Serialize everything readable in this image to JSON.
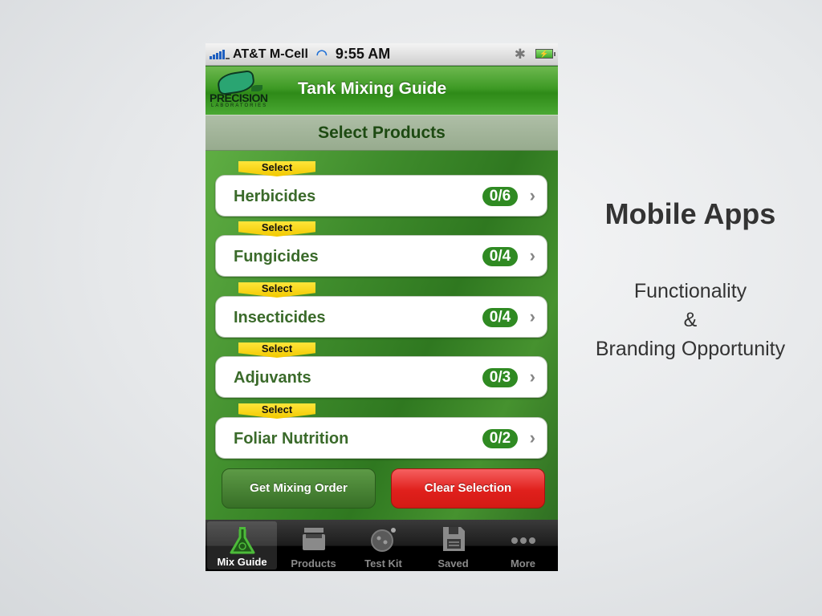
{
  "slide": {
    "title": "Mobile Apps",
    "subtitle_lines": [
      "Functionality",
      "&",
      "Branding Opportunity"
    ]
  },
  "status_bar": {
    "carrier": "AT&T M-Cell",
    "time": "9:55 AM",
    "icons": [
      "signal-icon",
      "wifi-icon",
      "bluetooth-icon",
      "battery-charging-icon"
    ]
  },
  "nav_bar": {
    "logo_word": "PRECISION",
    "logo_sub": "LABORATORIES",
    "title": "Tank Mixing Guide"
  },
  "sub_header": {
    "title": "Select Products"
  },
  "categories": [
    {
      "tag": "Select",
      "label": "Herbicides",
      "count": "0/6"
    },
    {
      "tag": "Select",
      "label": "Fungicides",
      "count": "0/4"
    },
    {
      "tag": "Select",
      "label": "Insecticides",
      "count": "0/4"
    },
    {
      "tag": "Select",
      "label": "Adjuvants",
      "count": "0/3"
    },
    {
      "tag": "Select",
      "label": "Foliar Nutrition",
      "count": "0/2"
    }
  ],
  "actions": {
    "mix_label": "Get Mixing Order",
    "clear_label": "Clear Selection"
  },
  "tab_bar": {
    "tabs": [
      {
        "label": "Mix Guide",
        "icon": "flask-icon",
        "active": true
      },
      {
        "label": "Products",
        "icon": "tray-icon",
        "active": false
      },
      {
        "label": "Test Kit",
        "icon": "test-kit-icon",
        "active": false
      },
      {
        "label": "Saved",
        "icon": "floppy-disk-icon",
        "active": false
      },
      {
        "label": "More",
        "icon": "more-dots-icon",
        "active": false
      }
    ]
  },
  "colors": {
    "brand_green": "#2f8a22",
    "clear_red": "#e0201c",
    "select_yellow": "#f2c900"
  }
}
